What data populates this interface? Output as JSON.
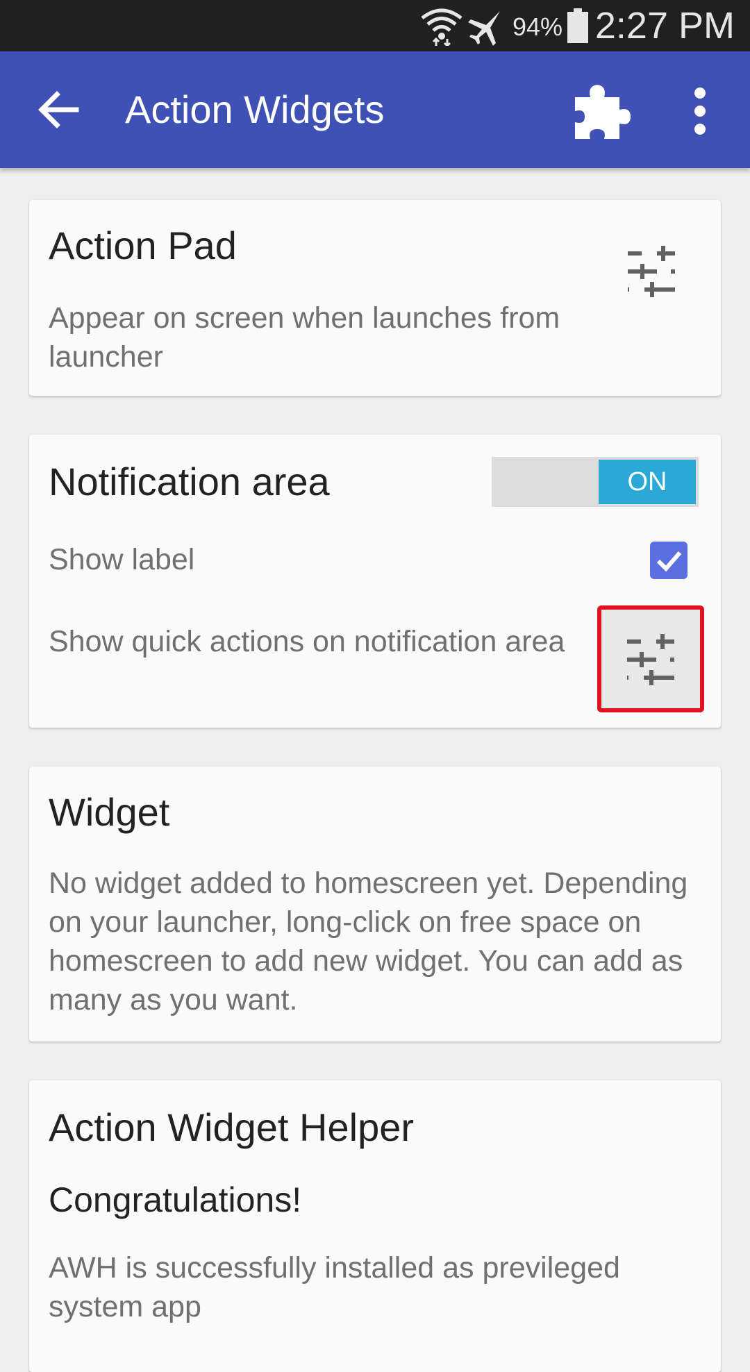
{
  "status_bar": {
    "battery_percent": "94%",
    "time": "2:27 PM",
    "icons": [
      "wifi-icon",
      "airplane-mode-icon",
      "battery-icon"
    ]
  },
  "app_bar": {
    "title": "Action Widgets",
    "icons": [
      "back-arrow-icon",
      "puzzle-icon",
      "more-vert-icon"
    ],
    "color": "#3f51b5"
  },
  "cards": {
    "action_pad": {
      "title": "Action Pad",
      "description": "Appear on screen when launches from launcher",
      "icon": "tune-icon"
    },
    "notification_area": {
      "title": "Notification area",
      "toggle_label": "ON",
      "toggle_state": true,
      "show_label_text": "Show label",
      "show_label_checked": true,
      "quick_actions_text": "Show quick actions on notification area",
      "quick_actions_icon": "tune-icon"
    },
    "widget": {
      "title": "Widget",
      "description": "No widget added to homescreen yet. Depending on your launcher, long-click on free space on homescreen to add new widget. You can add as many as you want."
    },
    "helper": {
      "title": "Action Widget Helper",
      "subtitle": "Congratulations!",
      "description": "AWH is successfully installed as previleged system app"
    }
  },
  "colors": {
    "accent_toggle": "#2aa9d6",
    "checkbox": "#5b6fe0",
    "highlight_border": "#e0131e"
  }
}
